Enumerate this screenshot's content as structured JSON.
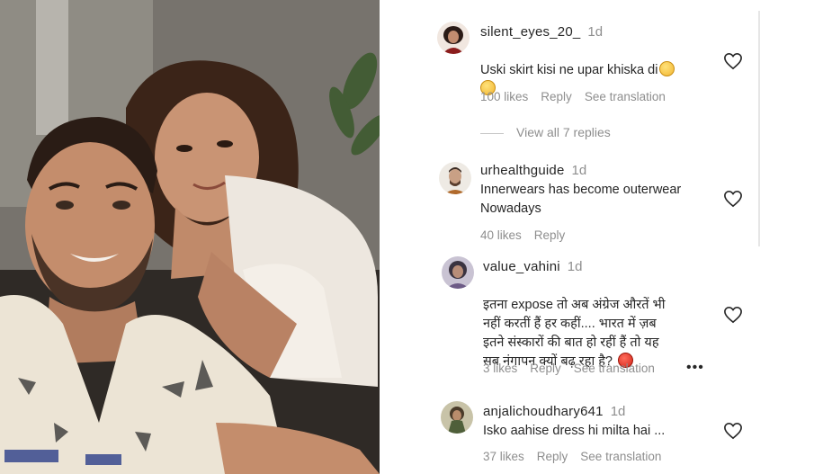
{
  "comments": [
    {
      "username": "silent_eyes_20_",
      "age": "1d",
      "text": "Uski skirt kisi ne upar khiska di",
      "likes": "100 likes",
      "reply": "Reply",
      "translate": "See translation",
      "emoji": [
        "grinning-squinting-face-emoji",
        "grinning-squinting-face-emoji"
      ],
      "avatar_color": "#3a2a2a"
    },
    {
      "username": "urhealthguide",
      "age": "1d",
      "text": "Innerwears has become outerwear\nNowadays",
      "likes": "40 likes",
      "reply": "Reply",
      "avatar_color": "#e8e3dc"
    },
    {
      "username": "value_vahini",
      "age": "1d",
      "text": "इतना expose तो अब अंग्रेज औरतें भी\nनहीं करतीं हैं हर कहीं.... भारत में ज़ब\nइतने संस्कारों की बात हो रहीं हैं तो यह\nसब नंगापन क्यों बढ़ रहा है?",
      "likes": "3 likes",
      "reply": "Reply",
      "translate": "See translation",
      "emoji": [
        "angry-face-emoji"
      ],
      "more": "•••",
      "avatar_color": "#9a95a5"
    },
    {
      "username": "anjalichoudhary641",
      "age": "1d",
      "text": "Isko aahise dress hi milta hai ...",
      "likes": "37 likes",
      "reply": "Reply",
      "translate": "See translation",
      "avatar_color": "#6e7b5a"
    }
  ],
  "view_replies": "View all 7 replies",
  "colors": {
    "text_primary": "#262626",
    "text_secondary": "#8e8e8e",
    "background": "#ffffff"
  }
}
